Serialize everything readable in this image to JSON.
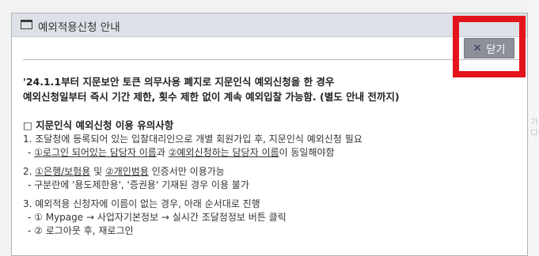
{
  "dialog": {
    "title": "예외적용신청 안내",
    "close_label": "닫기",
    "close_icon": "✕"
  },
  "notice": {
    "line1": "'24.1.1부터 지문보안 토큰 의무사용 폐지로 지문인식 예외신청을 한 경우",
    "line2": "예외신청일부터 즉시 기간 제한, 횟수 제한 없이 계속 예외입찰 가능함. (별도 안내 전까지)"
  },
  "section": {
    "title": "□ 지문인식 예외신청 이용 유의사항",
    "item1": {
      "main": "1. 조달청에 등록되어 있는 입찰대리인으로 개별 회원가입 후, 지문인식 예외신청 필요",
      "sub_prefix": "- ",
      "sub_part1": "①로그인 되어있는 담당자 이름",
      "sub_and": "과 ",
      "sub_part2": "②예외신청하는 담당자 이름",
      "sub_suffix": "이 동일해야함"
    },
    "item2": {
      "main_prefix": "2. ",
      "main_part1": "①은행/보험용",
      "main_and": " 및 ",
      "main_part2": "②개인범용",
      "main_suffix": " 인증서만 이용가능",
      "sub": "- 구분란에 '용도제한용', '증권용' 기재된 경우 이용 불가"
    },
    "item3": {
      "main": "3. 예외적용 신청자에 이름이 없는 경우, 아래 순서대로 진행",
      "sub1": "- ① Mypage → 사업자기본정보 → 실시간 조달정정보 버튼 클릭",
      "sub2": "- ② 로그아웃 후, 재로그인"
    }
  },
  "background": {
    "fragment1": "가",
    "fragment2": "다"
  }
}
